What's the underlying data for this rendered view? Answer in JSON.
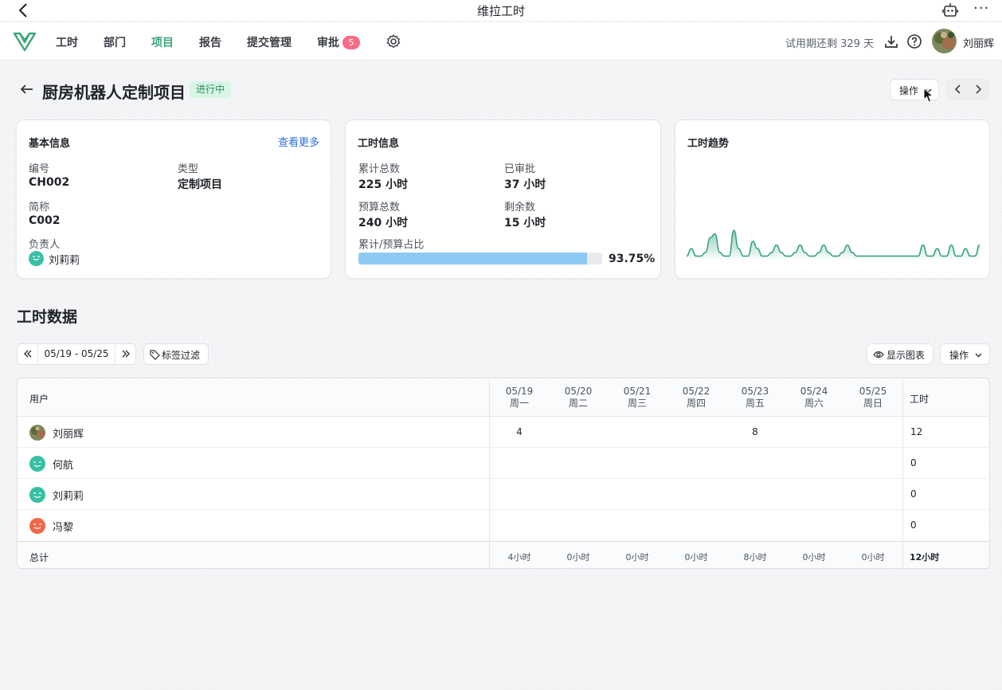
{
  "window": {
    "title": "维拉工时"
  },
  "nav": {
    "items": [
      {
        "label": "工时",
        "active": false
      },
      {
        "label": "部门",
        "active": false
      },
      {
        "label": "项目",
        "active": true
      },
      {
        "label": "报告",
        "active": false
      },
      {
        "label": "提交管理",
        "active": false
      },
      {
        "label": "审批",
        "active": false,
        "badge": "5"
      }
    ],
    "trial_text": "试用期还剩 329 天",
    "username": "刘丽辉"
  },
  "page": {
    "title": "厨房机器人定制项目",
    "status": "进行中",
    "operate_label": "操作"
  },
  "basic_info": {
    "title": "基本信息",
    "more_link": "查看更多",
    "code_label": "编号",
    "code_value": "CH002",
    "type_label": "类型",
    "type_value": "定制项目",
    "short_label": "简称",
    "short_value": "C002",
    "owner_label": "负责人",
    "owner_value": "刘莉莉"
  },
  "hours_info": {
    "title": "工时信息",
    "total_label": "累计总数",
    "total_value": "225 小时",
    "approved_label": "已审批",
    "approved_value": "37 小时",
    "budget_label": "预算总数",
    "budget_value": "240 小时",
    "remaining_label": "剩余数",
    "remaining_value": "15 小时",
    "ratio_label": "累计/预算占比",
    "ratio_value": "93.75%",
    "ratio_fraction": 0.9375
  },
  "trend": {
    "title": "工时趋势",
    "line_color": "#3aa57a",
    "values": [
      1,
      3,
      1,
      1,
      2,
      6,
      7,
      2,
      1,
      1,
      8,
      3,
      1,
      1,
      5,
      3,
      1,
      1,
      2,
      4,
      2,
      1,
      1,
      2,
      4,
      2,
      1,
      1,
      2,
      4,
      2,
      1,
      1,
      2,
      4,
      2,
      1,
      1,
      1,
      1,
      1,
      1,
      1,
      1,
      1,
      1,
      1,
      1,
      1,
      1,
      4,
      1,
      1,
      3,
      1,
      1,
      4,
      1,
      1,
      3,
      1,
      1,
      4
    ]
  },
  "worktime": {
    "section_title": "工时数据",
    "date_range": "05/19 - 05/25",
    "tag_filter_label": "标签过滤",
    "show_chart_label": "显示图表",
    "operate_label": "操作",
    "table": {
      "user_header": "用户",
      "total_header": "工时",
      "days": [
        {
          "date": "05/19",
          "weekday": "周一"
        },
        {
          "date": "05/20",
          "weekday": "周二"
        },
        {
          "date": "05/21",
          "weekday": "周三"
        },
        {
          "date": "05/22",
          "weekday": "周四"
        },
        {
          "date": "05/23",
          "weekday": "周五"
        },
        {
          "date": "05/24",
          "weekday": "周六"
        },
        {
          "date": "05/25",
          "weekday": "周日"
        }
      ],
      "rows": [
        {
          "name": "刘丽辉",
          "avatar": "photo",
          "cells": [
            "4",
            "",
            "",
            "",
            "8",
            "",
            ""
          ],
          "total": "12"
        },
        {
          "name": "何航",
          "avatar": "teal",
          "cells": [
            "",
            "",
            "",
            "",
            "",
            "",
            ""
          ],
          "total": "0"
        },
        {
          "name": "刘莉莉",
          "avatar": "teal",
          "cells": [
            "",
            "",
            "",
            "",
            "",
            "",
            ""
          ],
          "total": "0"
        },
        {
          "name": "冯黎",
          "avatar": "orange",
          "cells": [
            "",
            "",
            "",
            "",
            "",
            "",
            ""
          ],
          "total": "0"
        }
      ],
      "footer_label": "总计",
      "footer_cells": [
        "4小时",
        "0小时",
        "0小时",
        "0小时",
        "8小时",
        "0小时",
        "0小时"
      ],
      "footer_total": "12小时"
    }
  }
}
